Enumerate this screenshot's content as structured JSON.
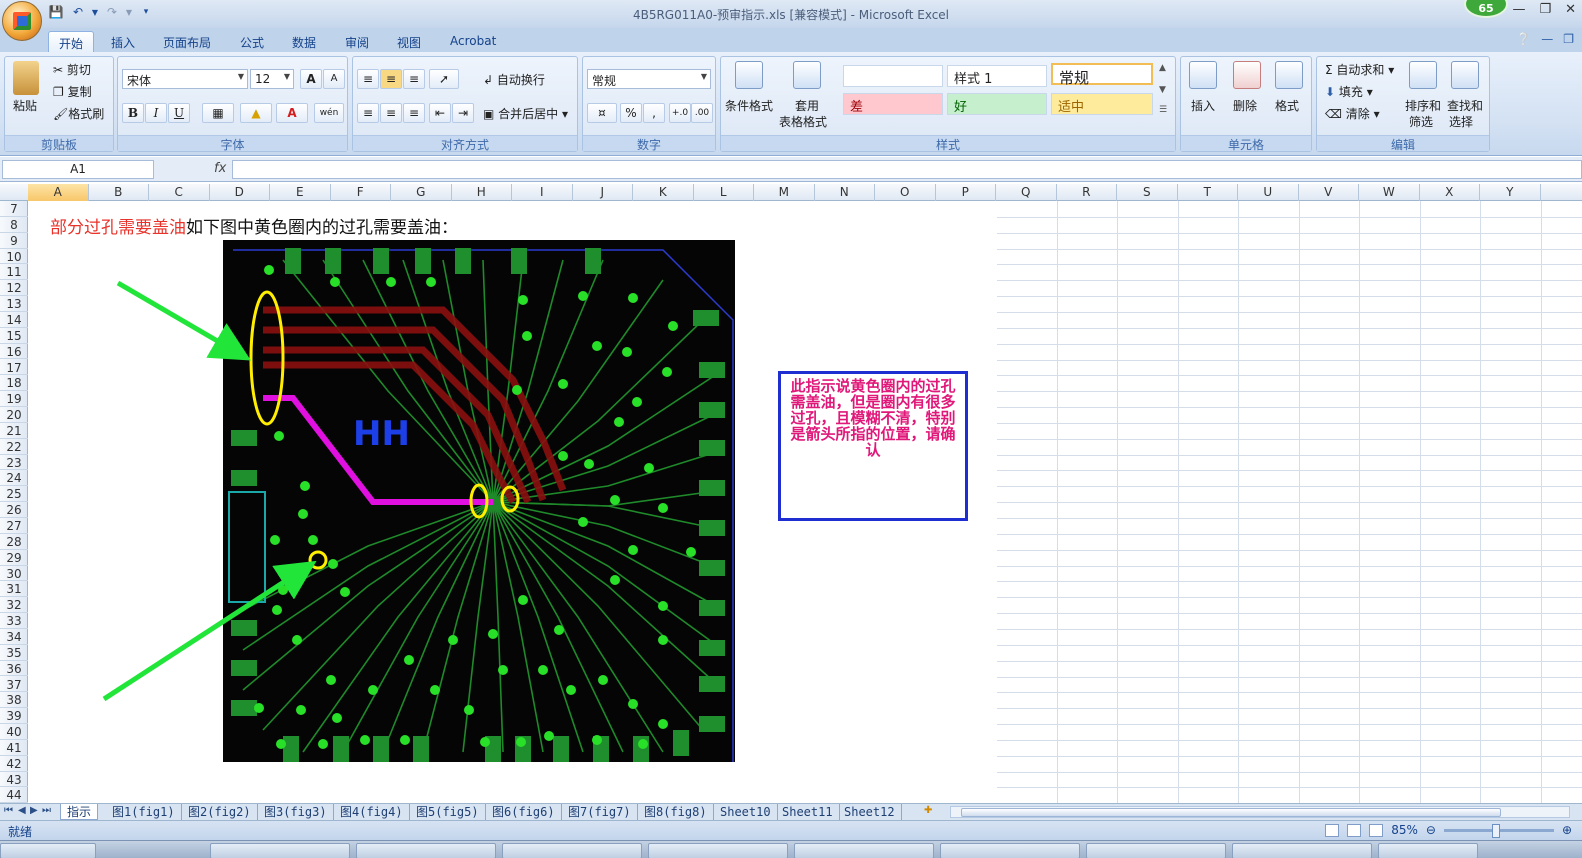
{
  "window": {
    "title": "4B5RG011A0-预审指示.xls  [兼容模式] - Microsoft Excel",
    "badge_count": "65"
  },
  "tabs": [
    "开始",
    "插入",
    "页面布局",
    "公式",
    "数据",
    "审阅",
    "视图",
    "Acrobat"
  ],
  "ribbon": {
    "clipboard": {
      "title": "剪贴板",
      "paste": "粘贴",
      "cut": "剪切",
      "copy": "复制",
      "format_painter": "格式刷"
    },
    "font": {
      "title": "字体",
      "font_name": "宋体",
      "font_size": "12",
      "bold": "B",
      "italic": "I",
      "underline": "U",
      "grow": "A",
      "shrink": "A",
      "font_color_letter": "A",
      "phonetic": "wén"
    },
    "alignment": {
      "title": "对齐方式",
      "wrap_text": "自动换行",
      "merge_center": "合并后居中"
    },
    "number": {
      "title": "数字",
      "format": "常规",
      "percent": "%",
      "comma": ","
    },
    "styles": {
      "title": "样式",
      "conditional": "条件格式",
      "table_line1": "套用",
      "table_line2": "表格格式",
      "style1": "样式 1",
      "normal": "常规",
      "bad": "差",
      "good": "好",
      "neutral": "适中"
    },
    "cells": {
      "title": "单元格",
      "insert": "插入",
      "delete": "删除",
      "format": "格式"
    },
    "editing": {
      "title": "编辑",
      "autosum": "自动求和",
      "fill": "填充",
      "clear": "清除",
      "sort_line1": "排序和",
      "sort_line2": "筛选",
      "find_line1": "查找和",
      "find_line2": "选择"
    }
  },
  "formula_bar": {
    "name_box": "A1",
    "fx": "fx",
    "content": ""
  },
  "columns": [
    "A",
    "B",
    "C",
    "D",
    "E",
    "F",
    "G",
    "H",
    "I",
    "J",
    "K",
    "L",
    "M",
    "N",
    "O",
    "P",
    "Q",
    "R",
    "S",
    "T",
    "U",
    "V",
    "W",
    "X",
    "Y"
  ],
  "rows": [
    "7",
    "8",
    "9",
    "10",
    "11",
    "12",
    "13",
    "14",
    "15",
    "16",
    "17",
    "18",
    "19",
    "20",
    "21",
    "22",
    "23",
    "24",
    "25",
    "26",
    "27",
    "28",
    "29",
    "30",
    "31",
    "32",
    "33",
    "34",
    "35",
    "36",
    "37",
    "38",
    "39",
    "40",
    "41",
    "42",
    "43",
    "44"
  ],
  "content": {
    "instruction_red": "部分过孔需要盖油",
    "instruction_black": "如下图中黄色圈内的过孔需要盖油：",
    "note": "此指示说黄色圈内的过孔需盖油，但是圈内有很多过孔，且模糊不清，特别是箭头所指的位置，请确认"
  },
  "sheet_tabs": [
    "指示",
    "图1(fig1)",
    "图2(fig2)",
    "图3(fig3)",
    "图4(fig4)",
    "图5(fig5)",
    "图6(fig6)",
    "图7(fig7)",
    "图8(fig8)",
    "Sheet10",
    "Sheet11",
    "Sheet12"
  ],
  "status": {
    "ready": "就绪",
    "zoom": "85%"
  },
  "colors": {
    "accent": "#15428b",
    "instruction_red": "#e8322a",
    "note_text": "#e0187a",
    "note_border": "#1f2ed1",
    "arrow": "#22e53a",
    "circle": "#ffee00"
  }
}
